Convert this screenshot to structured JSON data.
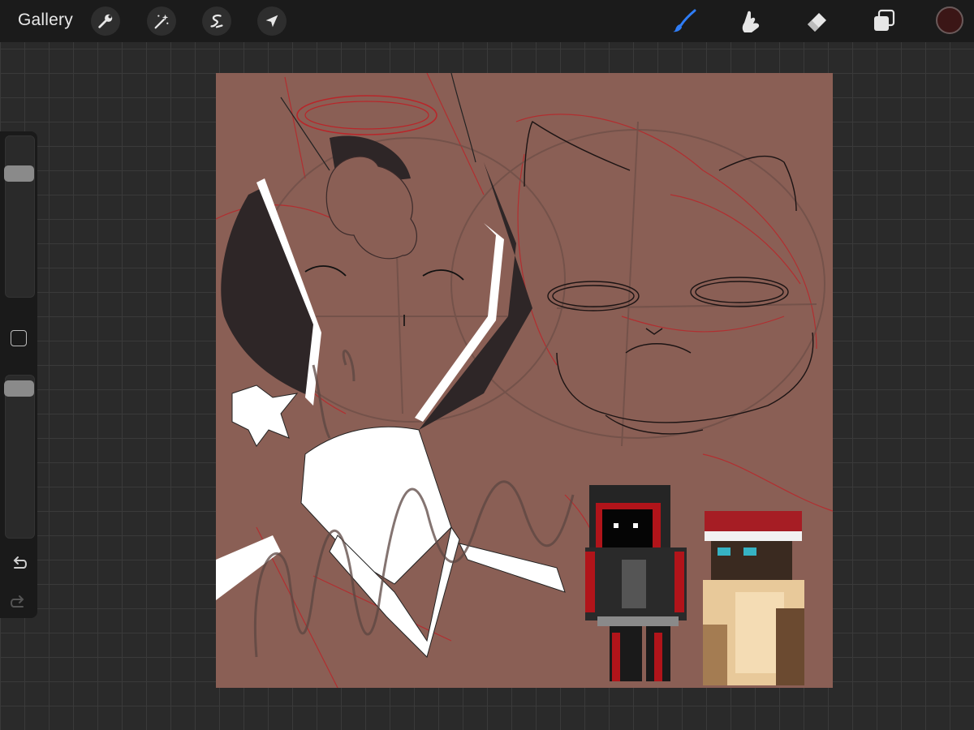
{
  "topbar": {
    "gallery_label": "Gallery",
    "left_tools": [
      {
        "icon": "wrench-icon",
        "name": "actions"
      },
      {
        "icon": "magic-wand-icon",
        "name": "adjustments"
      },
      {
        "icon": "selection-icon",
        "name": "selection"
      },
      {
        "icon": "arrow-cursor-icon",
        "name": "transform"
      }
    ],
    "right_tools": [
      {
        "icon": "brush-icon",
        "name": "paint",
        "active": true
      },
      {
        "icon": "smudge-icon",
        "name": "smudge"
      },
      {
        "icon": "eraser-icon",
        "name": "erase"
      },
      {
        "icon": "layers-icon",
        "name": "layers"
      }
    ],
    "current_color": "#3b1616"
  },
  "sidebar": {
    "brush_size_level": 0.79,
    "opacity_level": 0.96,
    "icons": [
      "modify-square-icon",
      "undo-icon",
      "redo-icon"
    ]
  },
  "colors": {
    "accent": "#2f7df6",
    "canvas_background": "#8a5f55",
    "topbar": "#1b1b1b"
  }
}
